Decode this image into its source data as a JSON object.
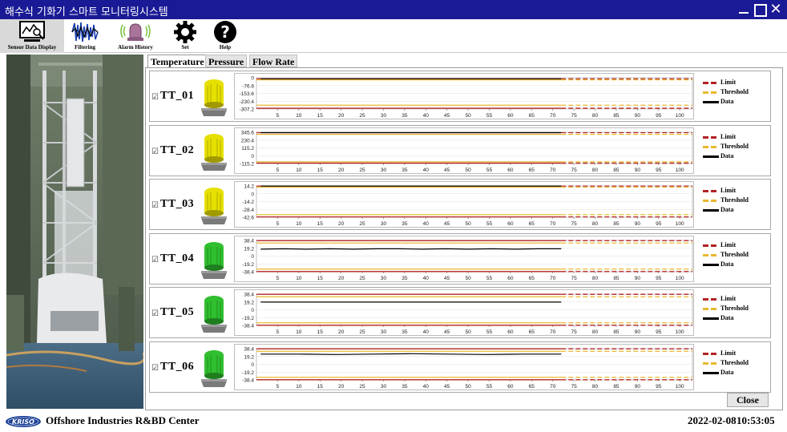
{
  "window": {
    "title": "해수식 기화기 스마트 모니터링시스템",
    "close_glyph": "✕"
  },
  "toolbar": {
    "items": [
      {
        "label": "Sensor Data Display",
        "icon": "monitor-chart-icon",
        "active": true
      },
      {
        "label": "Filtering",
        "icon": "waveform-icon"
      },
      {
        "label": "Alarm History",
        "icon": "alarm-bell-icon"
      },
      {
        "label": "Set",
        "icon": "gear-icon"
      },
      {
        "label": "Help",
        "icon": "question-icon"
      }
    ]
  },
  "tabs": [
    {
      "label": "Temperature",
      "active": true
    },
    {
      "label": "Pressure"
    },
    {
      "label": "Flow Rate"
    }
  ],
  "checkbox_glyph": "☑",
  "legend": {
    "limit": "Limit",
    "threshold": "Threshold",
    "data": "Data"
  },
  "colors": {
    "limit": "#b22222",
    "threshold": "#e8b830",
    "data": "#000000",
    "lamp_yellow": "#e6e000",
    "lamp_green": "#2fbf2f",
    "titlebar": "#1a1a96"
  },
  "x_ticks": [
    "5",
    "10",
    "15",
    "20",
    "25",
    "30",
    "35",
    "40",
    "45",
    "50",
    "55",
    "60",
    "65",
    "70",
    "75",
    "80",
    "85",
    "90",
    "95",
    "100"
  ],
  "sensors": [
    {
      "name": "TT_01",
      "lamp": "yellow",
      "y_ticks": [
        "0",
        "-76.8",
        "-153.6",
        "-230.4",
        "-307.2"
      ],
      "ylim": [
        -307.2,
        0
      ],
      "limits": [
        -10,
        -300
      ],
      "thresholds": [
        -20,
        -270
      ],
      "data": [
        -10,
        -10,
        -10,
        -10,
        -10
      ]
    },
    {
      "name": "TT_02",
      "lamp": "yellow",
      "y_ticks": [
        "345.6",
        "230.4",
        "115.2",
        "0",
        "-115.2"
      ],
      "ylim": [
        -115.2,
        345.6
      ],
      "limits": [
        340,
        -110
      ],
      "thresholds": [
        315,
        -90
      ],
      "data": [
        340,
        340,
        340,
        340,
        340
      ]
    },
    {
      "name": "TT_03",
      "lamp": "yellow",
      "y_ticks": [
        "14.2",
        "0",
        "-14.2",
        "-28.4",
        "-42.6"
      ],
      "ylim": [
        -42.6,
        14.2
      ],
      "limits": [
        14,
        -42
      ],
      "thresholds": [
        12,
        -38
      ],
      "data": [
        14,
        14,
        14,
        14,
        14
      ]
    },
    {
      "name": "TT_04",
      "lamp": "green",
      "y_ticks": [
        "38.4",
        "19.2",
        "0",
        "-19.2",
        "-38.4"
      ],
      "ylim": [
        -38.4,
        38.4
      ],
      "limits": [
        38,
        -38
      ],
      "thresholds": [
        32,
        -32
      ],
      "data": [
        17,
        18,
        17,
        18,
        17,
        18,
        18,
        17,
        18,
        17,
        18,
        17,
        18,
        18
      ]
    },
    {
      "name": "TT_05",
      "lamp": "green",
      "y_ticks": [
        "38.4",
        "19.2",
        "0",
        "-19.2",
        "-38.4"
      ],
      "ylim": [
        -38.4,
        38.4
      ],
      "limits": [
        38,
        -38
      ],
      "thresholds": [
        32,
        -32
      ],
      "data": [
        19,
        19,
        19,
        19,
        19,
        19
      ]
    },
    {
      "name": "TT_06",
      "lamp": "green",
      "y_ticks": [
        "38.4",
        "19.2",
        "0",
        "-19.2",
        "-38.4"
      ],
      "ylim": [
        -38.4,
        38.4
      ],
      "limits": [
        38,
        -38
      ],
      "thresholds": [
        32,
        -32
      ],
      "data": [
        25,
        25,
        24,
        25,
        26,
        25,
        24,
        25,
        25
      ]
    }
  ],
  "data_x_end": 72,
  "x_max": 103,
  "close_label": "Close",
  "footer": {
    "logo_text": "KRISO",
    "org": "Offshore Industries R&BD Center",
    "date": "2022-02-08",
    "time": "10:53:05"
  }
}
